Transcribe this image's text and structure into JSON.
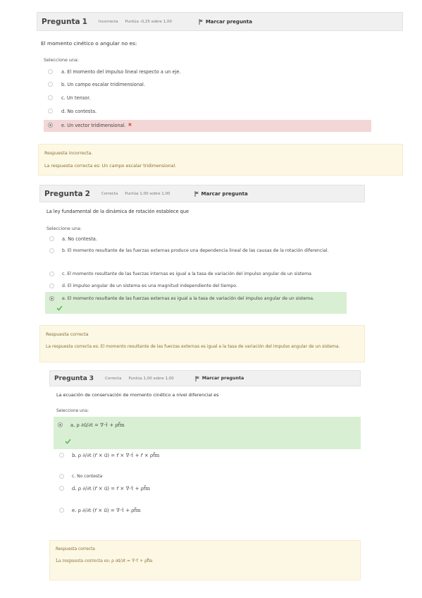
{
  "q1": {
    "title": "Pregunta",
    "number": "1",
    "state": "Incorrecta",
    "grade": "Puntúa -0,25 sobre 1,00",
    "flag": "Marcar pregunta",
    "text": "El momento cinético o angular no es:",
    "prompt": "Seleccione una:",
    "options": [
      "a. El momento del impulso lineal respecto a un eje.",
      "b. Un campo escalar tridimensional.",
      "c. Un tensor.",
      "d. No contesta.",
      "e. Un vector tridimensional."
    ],
    "feedback_status": "Respuesta incorrecta.",
    "feedback_answer": "La respuesta correcta es: Un campo escalar tridimensional."
  },
  "q2": {
    "title": "Pregunta",
    "number": "2",
    "state": "Correcta",
    "grade": "Puntúa 1,00 sobre 1,00",
    "flag": "Marcar pregunta",
    "text": "La ley fundamental de la dinámica de rotación establece que",
    "prompt": "Seleccione una:",
    "options": [
      "a. No contesta.",
      "b. El momento resultante de las fuerzas externas produce una dependencia lineal de las causas de la rotación diferencial.",
      "c. El momento resultante de las fuerzas internas es igual a la tasa de variación del impulso angular de un sistema",
      "d. El impulso angular de un sistema es una magnitud independiente del tiempo.",
      "e. El momento resultante de las fuerzas externas es igual a la tasa de variación del impulso angular de un sistema."
    ],
    "feedback_status": "Respuesta correcta",
    "feedback_answer": "La respuesta correcta es: El momento resultante de las fuerzas externas es igual a la tasa de variación del impulso angular de un sistema."
  },
  "q3": {
    "title": "Pregunta",
    "number": "3",
    "state": "Correcta",
    "grade": "Puntúa 1,00 sobre 1,00",
    "flag": "Marcar pregunta",
    "text": "La ecuación de conservación de momento cinético a nivel diferencial es",
    "prompt": "Seleccione una:",
    "options": [
      "a. ρ ∂u⃗/∂t = ∇·τ̄ + ρf⃗m",
      "b. ρ ∂/∂t (r⃗ × u⃗) = r⃗ × ∇·τ̄ + r⃗ × ρf⃗m",
      "c. No contesta",
      "d. ρ ∂/∂t (r⃗ × u⃗) = r⃗ × ∇·τ̄ + ρf⃗m",
      "e. ρ ∂/∂t (r⃗ × u⃗) = ∇·τ̄ + ρf⃗m"
    ],
    "feedback_status": "Respuesta correcta",
    "feedback_answer": "La respuesta correcta es: ρ ∂u⃗/∂t = ∇·τ̄ + ρf⃗m"
  },
  "colors": {
    "wrong_bg": "#f3d6d6",
    "right_bg": "#d9efd3",
    "feedback_bg": "#fcf8e3",
    "accent_red": "#d9534f",
    "accent_green": "#5cb85c"
  }
}
